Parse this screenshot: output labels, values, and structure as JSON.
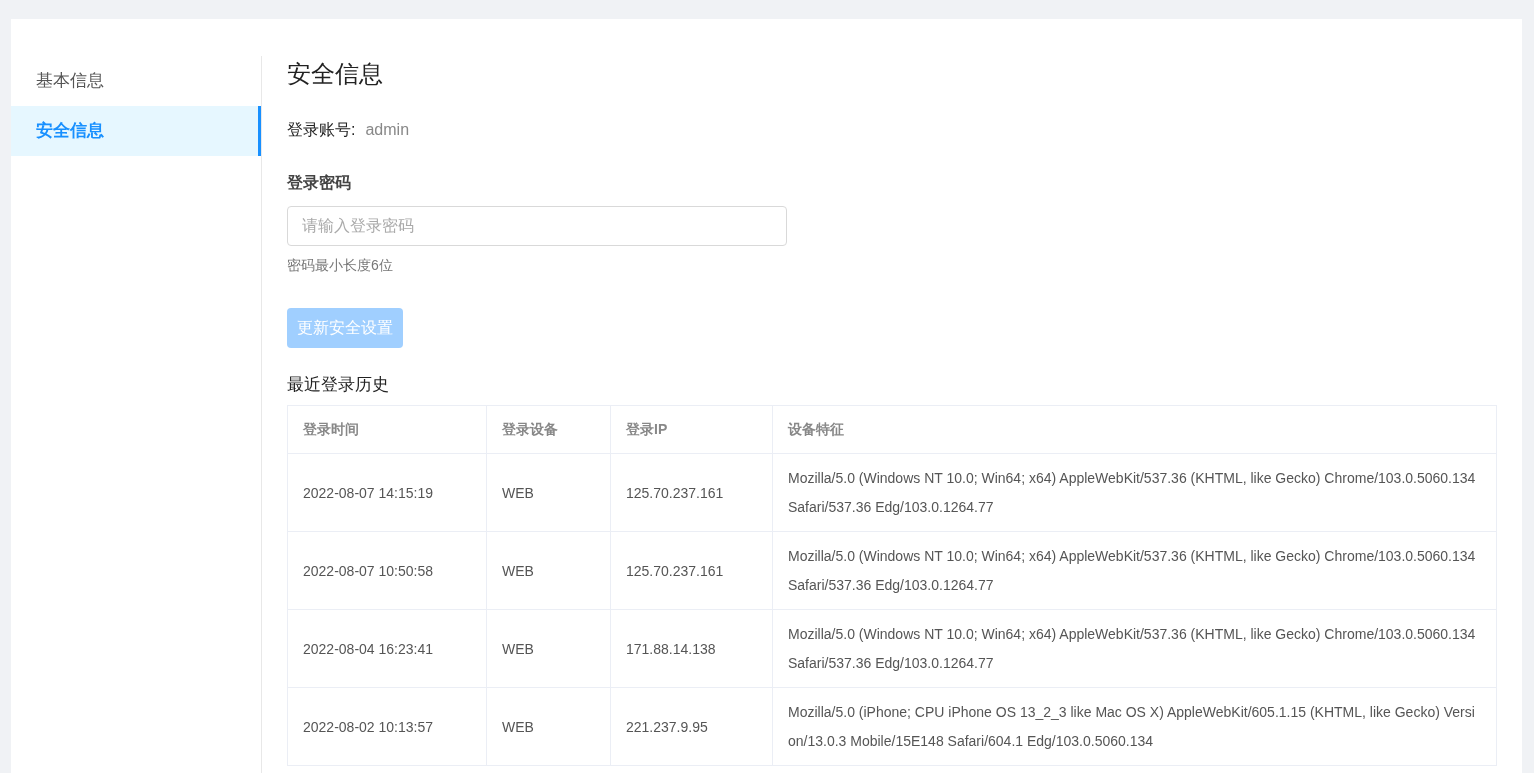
{
  "sidebar": {
    "items": [
      {
        "label": "基本信息",
        "selected": false
      },
      {
        "label": "安全信息",
        "selected": true
      }
    ]
  },
  "title": "安全信息",
  "account": {
    "label": "登录账号:",
    "value": "admin"
  },
  "password": {
    "label": "登录密码",
    "placeholder": "请输入登录密码",
    "hint": "密码最小长度6位"
  },
  "submit_button": {
    "label": "更新安全设置",
    "disabled": true
  },
  "history": {
    "title": "最近登录历史",
    "columns": [
      "登录时间",
      "登录设备",
      "登录IP",
      "设备特征"
    ],
    "rows": [
      {
        "time": "2022-08-07 14:15:19",
        "device": "WEB",
        "ip": "125.70.237.161",
        "agent": "Mozilla/5.0 (Windows NT 10.0; Win64; x64) AppleWebKit/537.36 (KHTML, like Gecko) Chrome/103.0.5060.134 Safari/537.36 Edg/103.0.1264.77"
      },
      {
        "time": "2022-08-07 10:50:58",
        "device": "WEB",
        "ip": "125.70.237.161",
        "agent": "Mozilla/5.0 (Windows NT 10.0; Win64; x64) AppleWebKit/537.36 (KHTML, like Gecko) Chrome/103.0.5060.134 Safari/537.36 Edg/103.0.1264.77"
      },
      {
        "time": "2022-08-04 16:23:41",
        "device": "WEB",
        "ip": "171.88.14.138",
        "agent": "Mozilla/5.0 (Windows NT 10.0; Win64; x64) AppleWebKit/537.36 (KHTML, like Gecko) Chrome/103.0.5060.134 Safari/537.36 Edg/103.0.1264.77"
      },
      {
        "time": "2022-08-02 10:13:57",
        "device": "WEB",
        "ip": "221.237.9.95",
        "agent": "Mozilla/5.0 (iPhone; CPU iPhone OS 13_2_3 like Mac OS X) AppleWebKit/605.1.15 (KHTML, like Gecko) Version/13.0.3 Mobile/15E148 Safari/604.1 Edg/103.0.5060.134"
      }
    ]
  }
}
